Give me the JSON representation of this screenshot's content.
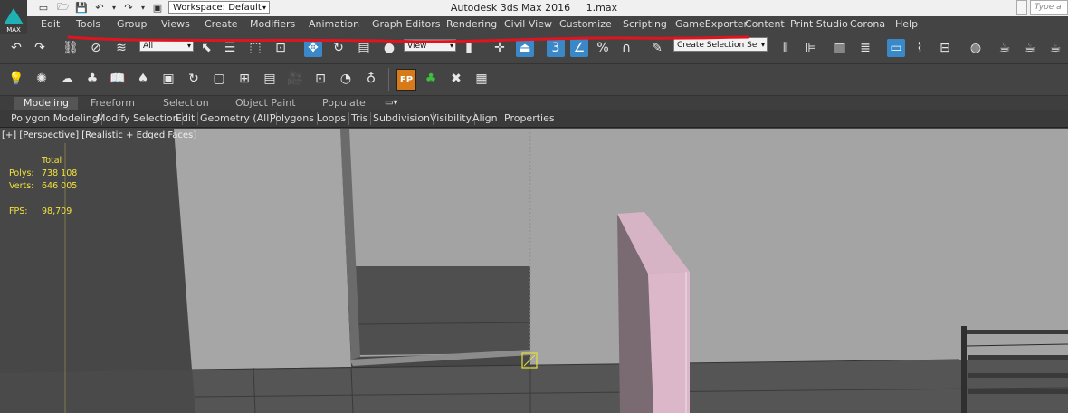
{
  "titlebar": {
    "workspace_label": "Workspace: Default",
    "app_name": "Autodesk 3ds Max 2016",
    "file_name": "1.max",
    "search_placeholder": "Type a k",
    "logo_text": "MAX"
  },
  "menu": [
    "Edit",
    "Tools",
    "Group",
    "Views",
    "Create",
    "Modifiers",
    "Animation",
    "Graph Editors",
    "Rendering",
    "Civil View",
    "Customize",
    "Scripting",
    "GameExporter",
    "Content",
    "Print Studio",
    "Corona",
    "Help"
  ],
  "toolbar": {
    "selection_filter": "All",
    "reference_coord": "View",
    "named_selection_placeholder": "Create Selection Se"
  },
  "ribbon": {
    "tabs": [
      "Modeling",
      "Freeform",
      "Selection",
      "Object Paint",
      "Populate"
    ],
    "panels": [
      "Polygon Modeling",
      "Modify Selection",
      "Edit",
      "Geometry (All)",
      "Polygons",
      "Loops",
      "Tris",
      "Subdivision",
      "Visibility",
      "Align",
      "Properties"
    ]
  },
  "viewport": {
    "label_plus": "[+]",
    "label_view": "[Perspective]",
    "label_shading": "[Realistic + Edged Faces]",
    "stats": {
      "total_label": "Total",
      "polys_label": "Polys:",
      "polys_value": "738 108",
      "verts_label": "Verts:",
      "verts_value": "646 005",
      "fps_label": "FPS:",
      "fps_value": "98,709"
    }
  },
  "colors": {
    "ui_background": "#444444",
    "accent_blue": "#3a88c8",
    "annotation_red": "#e0141e",
    "stats_yellow": "#f2e23c",
    "logo_teal": "#1fb1b4"
  }
}
